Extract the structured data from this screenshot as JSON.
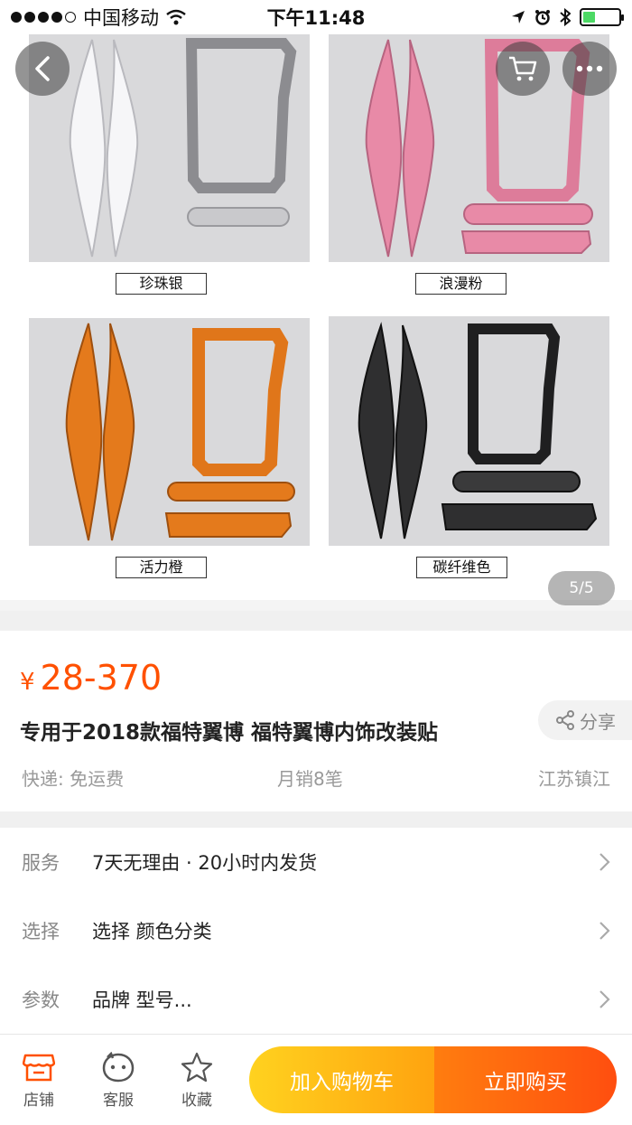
{
  "status_bar": {
    "carrier": "中国移动",
    "time": "下午11:48",
    "signal_filled": 4,
    "battery_level": 0.35,
    "battery_color": "#4cd964"
  },
  "gallery": {
    "captions": [
      "珍珠银",
      "浪漫粉",
      "活力橙",
      "碳纤维色"
    ],
    "page_indicator": "5/5",
    "tile_colors": [
      "#f0f0f2",
      "#e58aa6",
      "#e07818",
      "#2a2a2a"
    ]
  },
  "product": {
    "currency": "¥",
    "price": "28-370",
    "title": "专用于2018款福特翼博 福特翼博内饰改装贴",
    "share_label": "分享",
    "shipping": "快递: 免运费",
    "monthly_sales": "月销8笔",
    "location": "江苏镇江",
    "accent": "#ff5000"
  },
  "rows": [
    {
      "label": "服务",
      "value": "7天无理由 · 20小时内发货"
    },
    {
      "label": "选择",
      "value": "选择 颜色分类"
    },
    {
      "label": "参数",
      "value": "品牌 型号..."
    }
  ],
  "bottom_bar": {
    "store": "店铺",
    "service": "客服",
    "favorite": "收藏",
    "add_to_cart": "加入购物车",
    "buy_now": "立即购买"
  }
}
